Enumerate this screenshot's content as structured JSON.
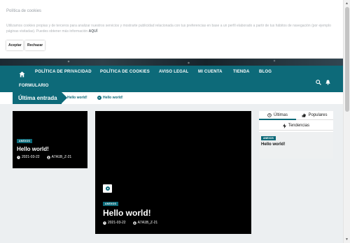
{
  "cookie": {
    "title": "Política de cookies",
    "text": "Utilizamos cookies propias y de terceros para analizar nuestros servicios y mostrarte publicidad relacionada con tus preferencias en base a un perfil elaborado a partir de tus hábitos de navegación (por ejemplo páginas visitadas). Puedes obtener más información",
    "link": "AQUÍ",
    "accept_label": "Aceptar",
    "reject_label": "Rechazar"
  },
  "nav": {
    "items": [
      "POLÍTICA DE PRIVACIDAD",
      "POLÍTICA DE COOKIES",
      "AVISO LEGAL",
      "MI CUENTA",
      "TIENDA",
      "BLOG",
      "FORMULARIO"
    ]
  },
  "ticker": {
    "label": "Última entrada",
    "links": [
      "Hello world!",
      "Hello world!"
    ]
  },
  "posts": {
    "small": {
      "badge": "ANEXOS",
      "title": "Hello world!",
      "date": "2021-03-22",
      "author": "A7A1B_Z-21"
    },
    "large": {
      "badge": "ANEXOS",
      "title": "Hello world!",
      "date": "2021-03-22",
      "author": "A7A1B_Z-21"
    }
  },
  "sidebar": {
    "tabs": [
      "Últimas",
      "Populares",
      "Tendencias"
    ],
    "badge": "ANEXOS",
    "title": "Hello world!"
  },
  "colors": {
    "accent": "#0d6a79"
  }
}
